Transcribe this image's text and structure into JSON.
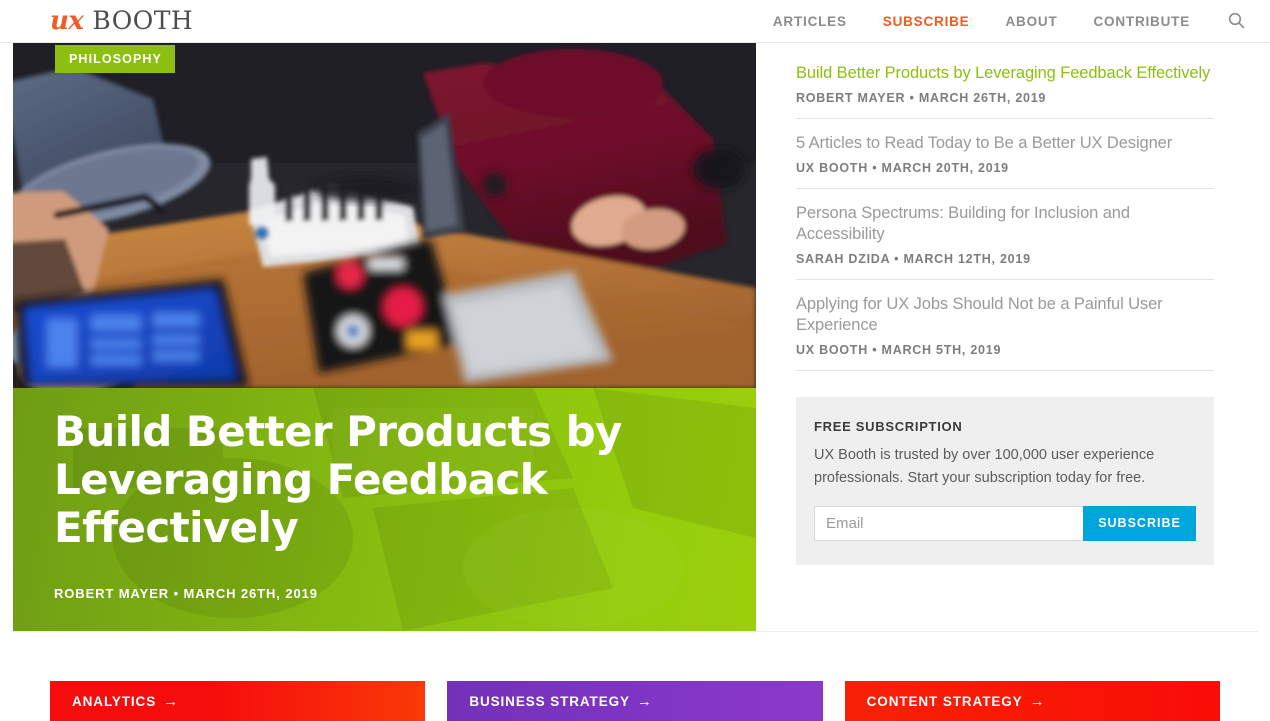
{
  "header": {
    "brand_mark": "ux",
    "brand_name": "BOOTH",
    "nav": [
      {
        "label": "ARTICLES",
        "active": false
      },
      {
        "label": "SUBSCRIBE",
        "active": true
      },
      {
        "label": "ABOUT",
        "active": false
      },
      {
        "label": "CONTRIBUTE",
        "active": false
      }
    ],
    "search_icon": "search-icon"
  },
  "hero": {
    "category": "PHILOSOPHY",
    "title": "Build Better Products by Leveraging Feedback Effectively",
    "author": "ROBERT MAYER",
    "separator": "•",
    "date": "MARCH 26TH, 2019",
    "meta": "ROBERT MAYER • MARCH 26TH, 2019",
    "accent_green": "#8cbf12"
  },
  "sidebar": {
    "articles": [
      {
        "title": "Build Better Products by Leveraging Feedback Effectively",
        "author": "ROBERT MAYER",
        "date": "MARCH 26TH, 2019",
        "meta": "ROBERT MAYER • MARCH 26TH, 2019",
        "featured": true
      },
      {
        "title": "5 Articles to Read Today to Be a Better UX Designer",
        "author": "UX BOOTH",
        "date": "MARCH 20TH, 2019",
        "meta": "UX BOOTH • MARCH 20TH, 2019",
        "featured": false
      },
      {
        "title": "Persona Spectrums: Building for Inclusion and Accessibility",
        "author": "SARAH DZIDA",
        "date": "MARCH 12TH, 2019",
        "meta": "SARAH DZIDA • MARCH 12TH, 2019",
        "featured": false
      },
      {
        "title": "Applying for UX Jobs Should Not be a Painful User Experience",
        "author": "UX BOOTH",
        "date": "MARCH 5TH, 2019",
        "meta": "UX BOOTH • MARCH 5TH, 2019",
        "featured": false
      }
    ],
    "subscribe": {
      "heading": "FREE SUBSCRIPTION",
      "copy": "UX Booth is trusted by over 100,000 user experience professionals. Start your subscription today for free.",
      "email_value": "",
      "email_placeholder": "Email",
      "button_label": "SUBSCRIBE",
      "button_color": "#00a5dc"
    }
  },
  "categories": [
    {
      "label": "ANALYTICS",
      "arrow": "→",
      "color": "#f50c0c"
    },
    {
      "label": "BUSINESS STRATEGY",
      "arrow": "→",
      "color": "#7b33ba"
    },
    {
      "label": "CONTENT STRATEGY",
      "arrow": "→",
      "color": "#f62205"
    }
  ]
}
